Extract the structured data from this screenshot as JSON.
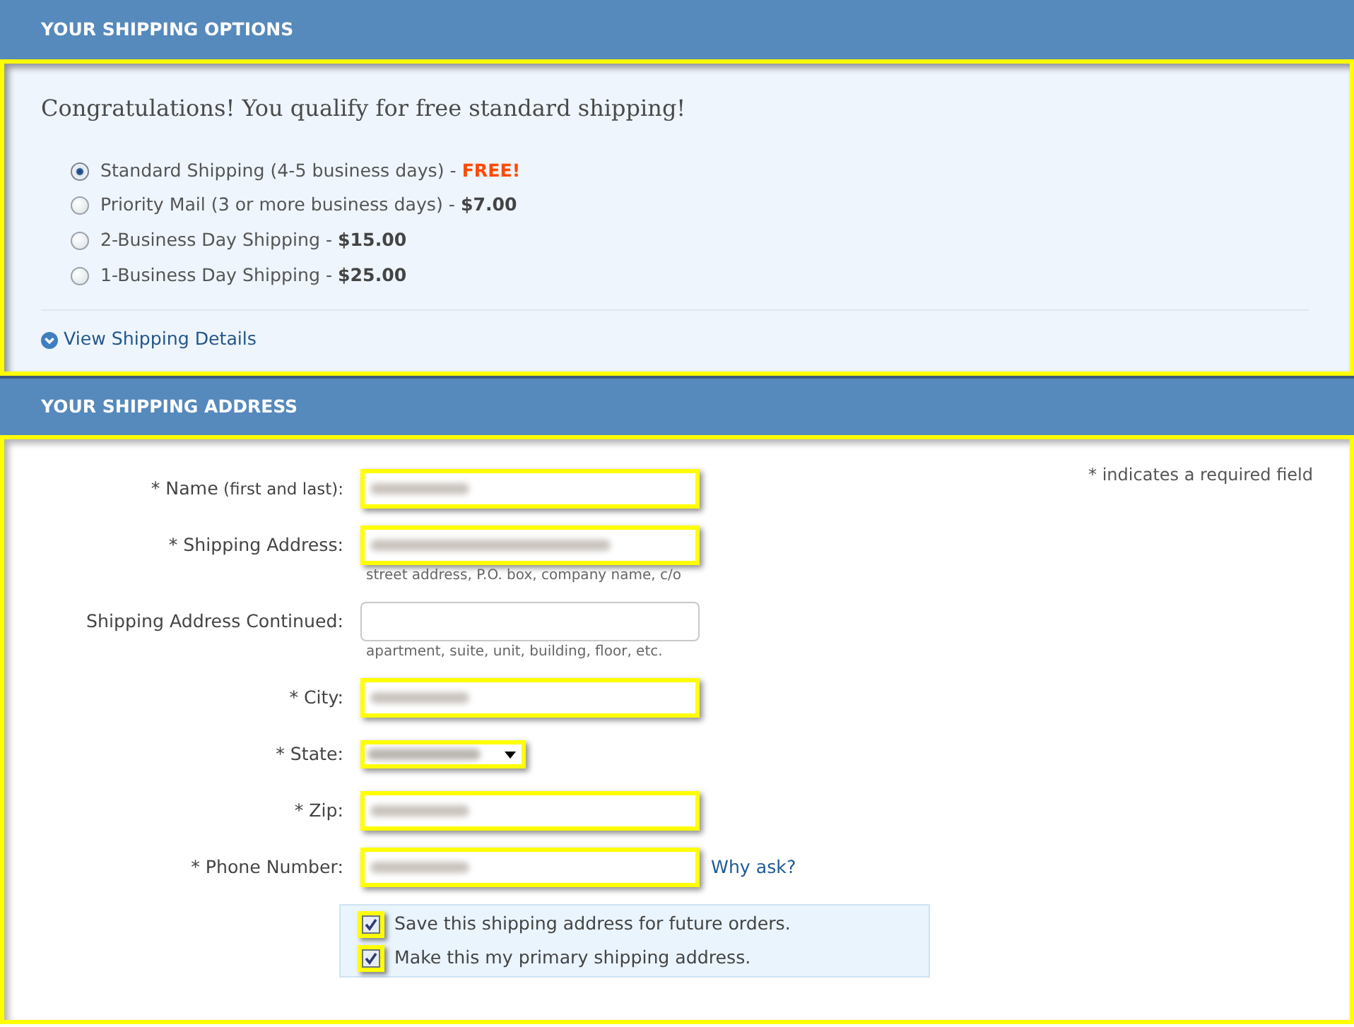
{
  "shipping_options": {
    "heading": "YOUR SHIPPING OPTIONS",
    "highlighted": true,
    "message": "Congratulations! You qualify for free standard shipping!",
    "options": [
      {
        "label": "Standard Shipping (4-5 business days) -",
        "price": "FREE!",
        "accent": true,
        "selected": true
      },
      {
        "label": "Priority Mail (3 or more business days) -",
        "price": "$7.00",
        "accent": false,
        "selected": false
      },
      {
        "label": "2-Business Day Shipping -",
        "price": "$15.00",
        "accent": false,
        "selected": false
      },
      {
        "label": "1-Business Day Shipping -",
        "price": "$25.00",
        "accent": false,
        "selected": false
      }
    ],
    "details_link": "View Shipping Details"
  },
  "shipping_address": {
    "heading": "YOUR SHIPPING ADDRESS",
    "highlighted": true,
    "required_note": "* indicates a required field",
    "fields": [
      {
        "kind": "text",
        "label": "* Name",
        "label_note": "(first and last):",
        "highlighted": true,
        "blurred": true
      },
      {
        "kind": "text",
        "label": "* Shipping Address:",
        "hint": "street address, P.O. box, company name, c/o",
        "highlighted": true,
        "blurred": true
      },
      {
        "kind": "text",
        "label": "Shipping Address Continued:",
        "hint": "apartment, suite, unit, building, floor, etc.",
        "highlighted": false,
        "blurred": false
      },
      {
        "kind": "text",
        "label": "* City:",
        "highlighted": true,
        "blurred": true
      },
      {
        "kind": "select",
        "label": "* State:",
        "highlighted": true,
        "blurred": true
      },
      {
        "kind": "text",
        "label": "* Zip:",
        "highlighted": true,
        "blurred": true
      },
      {
        "kind": "text",
        "label": "* Phone Number:",
        "link": "Why ask?",
        "highlighted": true,
        "blurred": true
      }
    ],
    "checkboxes": [
      {
        "label": "Save this shipping address for future orders.",
        "checked": true,
        "highlighted": true
      },
      {
        "label": "Make this my primary shipping address.",
        "checked": true,
        "highlighted": true
      }
    ]
  }
}
